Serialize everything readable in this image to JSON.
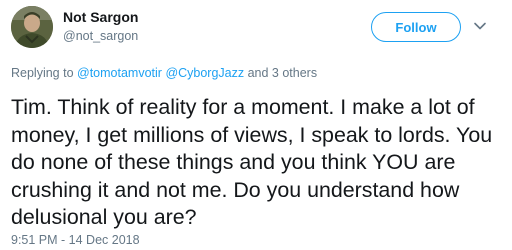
{
  "author": {
    "display_name": "Not Sargon",
    "handle": "@not_sargon"
  },
  "follow_button": {
    "label": "Follow"
  },
  "reply": {
    "prefix": "Replying to ",
    "mention_1": "@tomotamvotir",
    "mention_2": "@CyborgJazz",
    "suffix": " and 3 others"
  },
  "tweet": {
    "text": "Tim. Think of reality for a moment. I make a lot of money, I get millions of views, I speak to lords. You do none of these things and you think YOU are crushing it and not me. Do you understand how delusional you are?",
    "timestamp": "9:51 PM - 14 Dec 2018"
  },
  "colors": {
    "accent": "#1da1f2",
    "secondary_text": "#657786",
    "primary_text": "#14171a"
  },
  "icons": {
    "more_options": "chevron-down-icon"
  }
}
